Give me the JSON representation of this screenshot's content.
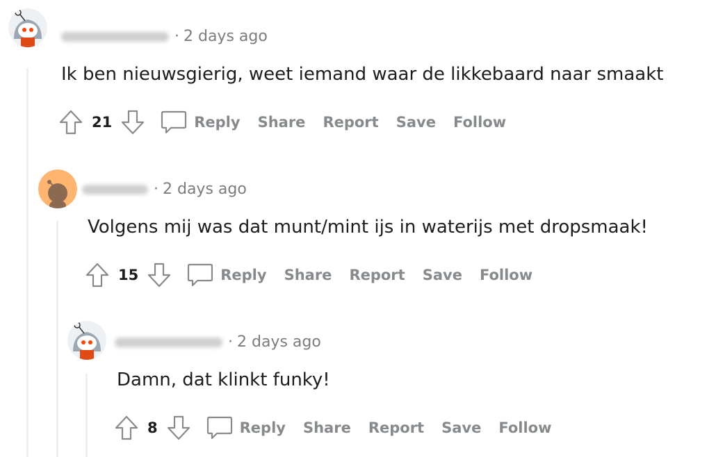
{
  "comments": [
    {
      "username": "",
      "time": "2 days ago",
      "body": "Ik ben nieuwsgierig, weet iemand waar de likkebaard naar smaakt",
      "votes": "21",
      "actions": {
        "reply": "Reply",
        "share": "Share",
        "report": "Report",
        "save": "Save",
        "follow": "Follow"
      }
    },
    {
      "username": "",
      "time": "2 days ago",
      "body": "Volgens mij was dat munt/mint ijs in waterijs met dropsmaak!",
      "votes": "15",
      "actions": {
        "reply": "Reply",
        "share": "Share",
        "report": "Report",
        "save": "Save",
        "follow": "Follow"
      }
    },
    {
      "username": "",
      "time": "2 days ago",
      "body": "Damn, dat klinkt funky!",
      "votes": "8",
      "actions": {
        "reply": "Reply",
        "share": "Share",
        "report": "Report",
        "save": "Save",
        "follow": "Follow"
      }
    }
  ],
  "colors": {
    "meta": "#7c7c7c",
    "action": "#878a8c",
    "thread_line": "#edeff1",
    "avatar_orange": "#ffb470"
  },
  "meta_separator": "·"
}
